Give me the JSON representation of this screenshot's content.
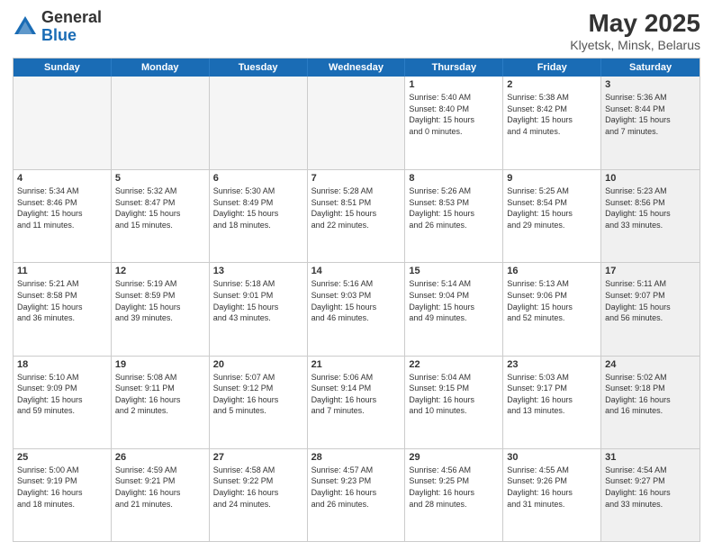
{
  "header": {
    "logo_general": "General",
    "logo_blue": "Blue",
    "title": "May 2025",
    "subtitle": "Klyetsk, Minsk, Belarus"
  },
  "weekdays": [
    "Sunday",
    "Monday",
    "Tuesday",
    "Wednesday",
    "Thursday",
    "Friday",
    "Saturday"
  ],
  "rows": [
    [
      {
        "day": "",
        "info": "",
        "empty": true
      },
      {
        "day": "",
        "info": "",
        "empty": true
      },
      {
        "day": "",
        "info": "",
        "empty": true
      },
      {
        "day": "",
        "info": "",
        "empty": true
      },
      {
        "day": "1",
        "info": "Sunrise: 5:40 AM\nSunset: 8:40 PM\nDaylight: 15 hours\nand 0 minutes.",
        "empty": false
      },
      {
        "day": "2",
        "info": "Sunrise: 5:38 AM\nSunset: 8:42 PM\nDaylight: 15 hours\nand 4 minutes.",
        "empty": false
      },
      {
        "day": "3",
        "info": "Sunrise: 5:36 AM\nSunset: 8:44 PM\nDaylight: 15 hours\nand 7 minutes.",
        "empty": false,
        "shaded": true
      }
    ],
    [
      {
        "day": "4",
        "info": "Sunrise: 5:34 AM\nSunset: 8:46 PM\nDaylight: 15 hours\nand 11 minutes.",
        "empty": false
      },
      {
        "day": "5",
        "info": "Sunrise: 5:32 AM\nSunset: 8:47 PM\nDaylight: 15 hours\nand 15 minutes.",
        "empty": false
      },
      {
        "day": "6",
        "info": "Sunrise: 5:30 AM\nSunset: 8:49 PM\nDaylight: 15 hours\nand 18 minutes.",
        "empty": false
      },
      {
        "day": "7",
        "info": "Sunrise: 5:28 AM\nSunset: 8:51 PM\nDaylight: 15 hours\nand 22 minutes.",
        "empty": false
      },
      {
        "day": "8",
        "info": "Sunrise: 5:26 AM\nSunset: 8:53 PM\nDaylight: 15 hours\nand 26 minutes.",
        "empty": false
      },
      {
        "day": "9",
        "info": "Sunrise: 5:25 AM\nSunset: 8:54 PM\nDaylight: 15 hours\nand 29 minutes.",
        "empty": false
      },
      {
        "day": "10",
        "info": "Sunrise: 5:23 AM\nSunset: 8:56 PM\nDaylight: 15 hours\nand 33 minutes.",
        "empty": false,
        "shaded": true
      }
    ],
    [
      {
        "day": "11",
        "info": "Sunrise: 5:21 AM\nSunset: 8:58 PM\nDaylight: 15 hours\nand 36 minutes.",
        "empty": false
      },
      {
        "day": "12",
        "info": "Sunrise: 5:19 AM\nSunset: 8:59 PM\nDaylight: 15 hours\nand 39 minutes.",
        "empty": false
      },
      {
        "day": "13",
        "info": "Sunrise: 5:18 AM\nSunset: 9:01 PM\nDaylight: 15 hours\nand 43 minutes.",
        "empty": false
      },
      {
        "day": "14",
        "info": "Sunrise: 5:16 AM\nSunset: 9:03 PM\nDaylight: 15 hours\nand 46 minutes.",
        "empty": false
      },
      {
        "day": "15",
        "info": "Sunrise: 5:14 AM\nSunset: 9:04 PM\nDaylight: 15 hours\nand 49 minutes.",
        "empty": false
      },
      {
        "day": "16",
        "info": "Sunrise: 5:13 AM\nSunset: 9:06 PM\nDaylight: 15 hours\nand 52 minutes.",
        "empty": false
      },
      {
        "day": "17",
        "info": "Sunrise: 5:11 AM\nSunset: 9:07 PM\nDaylight: 15 hours\nand 56 minutes.",
        "empty": false,
        "shaded": true
      }
    ],
    [
      {
        "day": "18",
        "info": "Sunrise: 5:10 AM\nSunset: 9:09 PM\nDaylight: 15 hours\nand 59 minutes.",
        "empty": false
      },
      {
        "day": "19",
        "info": "Sunrise: 5:08 AM\nSunset: 9:11 PM\nDaylight: 16 hours\nand 2 minutes.",
        "empty": false
      },
      {
        "day": "20",
        "info": "Sunrise: 5:07 AM\nSunset: 9:12 PM\nDaylight: 16 hours\nand 5 minutes.",
        "empty": false
      },
      {
        "day": "21",
        "info": "Sunrise: 5:06 AM\nSunset: 9:14 PM\nDaylight: 16 hours\nand 7 minutes.",
        "empty": false
      },
      {
        "day": "22",
        "info": "Sunrise: 5:04 AM\nSunset: 9:15 PM\nDaylight: 16 hours\nand 10 minutes.",
        "empty": false
      },
      {
        "day": "23",
        "info": "Sunrise: 5:03 AM\nSunset: 9:17 PM\nDaylight: 16 hours\nand 13 minutes.",
        "empty": false
      },
      {
        "day": "24",
        "info": "Sunrise: 5:02 AM\nSunset: 9:18 PM\nDaylight: 16 hours\nand 16 minutes.",
        "empty": false,
        "shaded": true
      }
    ],
    [
      {
        "day": "25",
        "info": "Sunrise: 5:00 AM\nSunset: 9:19 PM\nDaylight: 16 hours\nand 18 minutes.",
        "empty": false
      },
      {
        "day": "26",
        "info": "Sunrise: 4:59 AM\nSunset: 9:21 PM\nDaylight: 16 hours\nand 21 minutes.",
        "empty": false
      },
      {
        "day": "27",
        "info": "Sunrise: 4:58 AM\nSunset: 9:22 PM\nDaylight: 16 hours\nand 24 minutes.",
        "empty": false
      },
      {
        "day": "28",
        "info": "Sunrise: 4:57 AM\nSunset: 9:23 PM\nDaylight: 16 hours\nand 26 minutes.",
        "empty": false
      },
      {
        "day": "29",
        "info": "Sunrise: 4:56 AM\nSunset: 9:25 PM\nDaylight: 16 hours\nand 28 minutes.",
        "empty": false
      },
      {
        "day": "30",
        "info": "Sunrise: 4:55 AM\nSunset: 9:26 PM\nDaylight: 16 hours\nand 31 minutes.",
        "empty": false
      },
      {
        "day": "31",
        "info": "Sunrise: 4:54 AM\nSunset: 9:27 PM\nDaylight: 16 hours\nand 33 minutes.",
        "empty": false,
        "shaded": true
      }
    ]
  ]
}
